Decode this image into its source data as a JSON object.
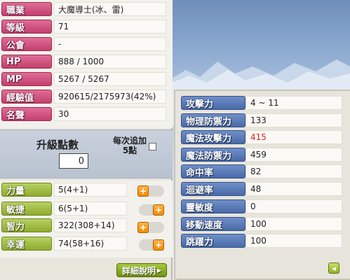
{
  "character": {
    "rows": [
      {
        "label": "職業",
        "value": "大魔導士(冰、雷)"
      },
      {
        "label": "等級",
        "value": "71"
      },
      {
        "label": "公會",
        "value": "-"
      },
      {
        "label": "HP",
        "value": "888 / 1000"
      },
      {
        "label": "MP",
        "value": "5267 / 5267"
      },
      {
        "label": "經驗值",
        "value": "920615/2175973(42%)"
      },
      {
        "label": "名聲",
        "value": "30"
      }
    ]
  },
  "ability_points": {
    "title": "升級點數",
    "value": "0",
    "auto_assign_note": "每次追加5點"
  },
  "stats": [
    {
      "label": "力量",
      "value": "5(4+1)"
    },
    {
      "label": "敏捷",
      "value": "6(5+1)"
    },
    {
      "label": "智力",
      "value": "322(308+14)"
    },
    {
      "label": "幸運",
      "value": "74(58+16)"
    }
  ],
  "stat_plus_icon": "+",
  "detail_button": {
    "label": "詳細說明",
    "arrow": "▸"
  },
  "detail": {
    "rows": [
      {
        "label": "攻擊力",
        "value": "4 ~ 11"
      },
      {
        "label": "物理防禦力",
        "value": "133"
      },
      {
        "label": "魔法攻擊力",
        "value": "415",
        "highlight": "#e02020"
      },
      {
        "label": "魔法防禦力",
        "value": "459"
      },
      {
        "label": "命中率",
        "value": "82"
      },
      {
        "label": "迴避率",
        "value": "48"
      },
      {
        "label": "靈敏度",
        "value": "0"
      },
      {
        "label": "移動速度",
        "value": "100"
      },
      {
        "label": "跳躍力",
        "value": "100"
      }
    ],
    "back_icon": "◂"
  },
  "colors": {
    "label_pink": "#c33f6e",
    "label_green": "#8fab2e",
    "label_blue": "#4a6aa8",
    "plus_orange": "#f08a00",
    "highlight_red": "#e02020"
  }
}
